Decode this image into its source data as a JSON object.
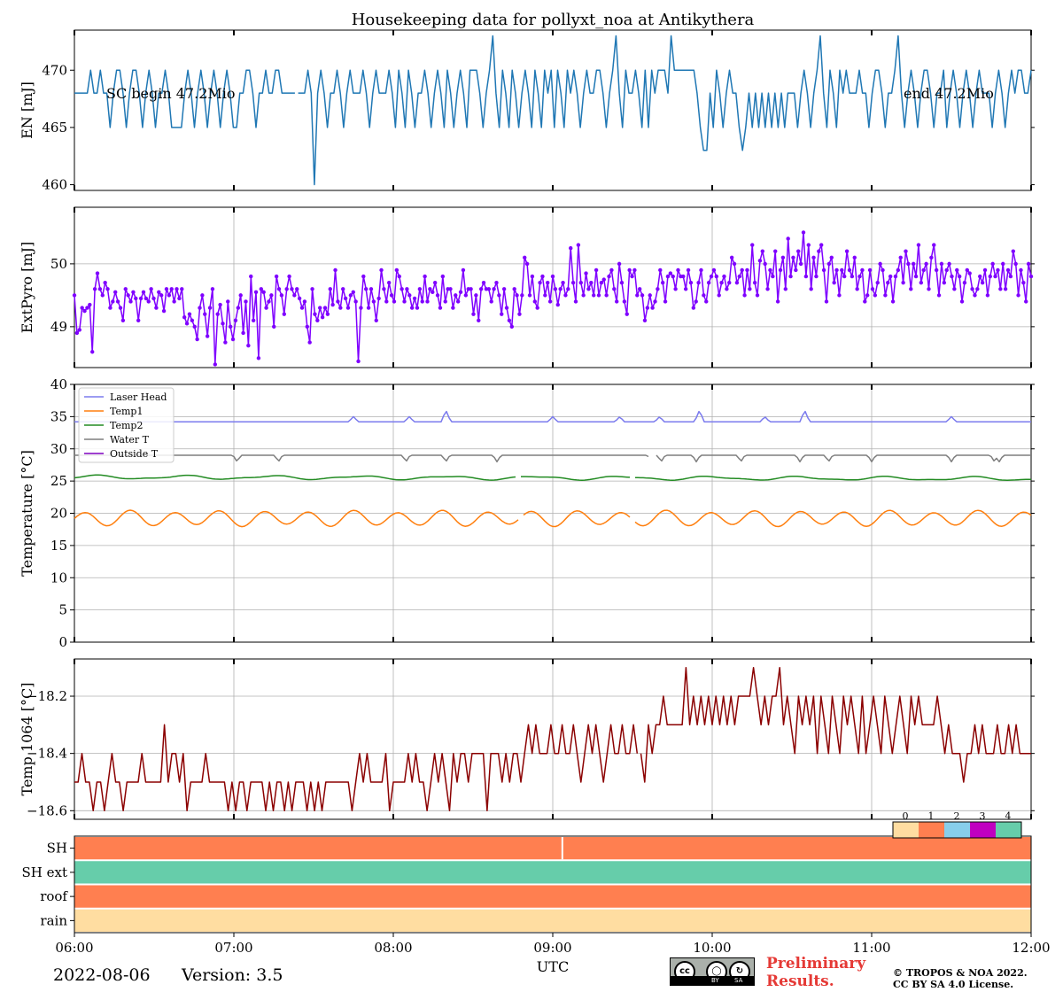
{
  "title": "Housekeeping data for pollyxt_noa at Antikythera",
  "footer": {
    "date": "2022-08-06",
    "version": "Version: 3.5",
    "cc_label": "cc",
    "cc_by": "BY",
    "cc_sa": "SA",
    "preliminary_line1": "Preliminary",
    "preliminary_line2": "Results.",
    "copyright_line1": "© TROPOS & NOA 2022.",
    "copyright_line2": "CC BY SA 4.0 License."
  },
  "chart_data": [
    {
      "id": "en",
      "type": "line",
      "ylabel": "EN [mJ]",
      "ylim": [
        459.5,
        473.5
      ],
      "yticks": [
        460,
        465,
        470
      ],
      "grid": false,
      "color": "#1f77b4",
      "annotations": [
        {
          "text": "SC begin 47.2Mio",
          "x": 6.2,
          "y": 468
        },
        {
          "text": "end 47.2Mio",
          "x": 11.2,
          "y": 468
        }
      ],
      "x_start": 6.0,
      "x_end": 12.0,
      "gaps": [
        7.4
      ],
      "values": [
        468,
        468,
        468,
        468,
        468,
        470,
        468,
        468,
        470,
        468,
        468,
        465,
        468,
        470,
        470,
        468,
        465,
        468,
        470,
        470,
        468,
        465,
        468,
        470,
        468,
        465,
        468,
        468,
        470,
        468,
        465,
        465,
        465,
        465,
        468,
        470,
        468,
        465,
        468,
        470,
        468,
        465,
        468,
        470,
        468,
        465,
        468,
        470,
        468,
        465,
        465,
        468,
        468,
        470,
        470,
        468,
        465,
        468,
        468,
        470,
        468,
        468,
        470,
        470,
        468,
        468,
        468,
        468,
        468,
        468,
        468,
        468,
        470,
        468,
        460,
        468,
        470,
        468,
        465,
        468,
        468,
        470,
        468,
        465,
        468,
        470,
        468,
        468,
        468,
        470,
        468,
        465,
        468,
        470,
        468,
        468,
        468,
        470,
        468,
        465,
        470,
        468,
        465,
        470,
        468,
        465,
        468,
        468,
        470,
        468,
        465,
        468,
        470,
        468,
        465,
        470,
        468,
        465,
        468,
        470,
        468,
        465,
        470,
        470,
        470,
        468,
        465,
        468,
        470,
        473,
        468,
        465,
        470,
        468,
        465,
        470,
        468,
        465,
        468,
        470,
        468,
        465,
        470,
        468,
        465,
        470,
        468,
        470,
        465,
        470,
        468,
        465,
        470,
        468,
        470,
        468,
        465,
        468,
        470,
        468,
        468,
        470,
        470,
        468,
        465,
        468,
        470,
        473,
        468,
        465,
        470,
        468,
        468,
        470,
        468,
        465,
        470,
        465,
        470,
        468,
        470,
        470,
        470,
        468,
        473,
        470,
        470,
        470,
        470,
        470,
        470,
        470,
        468,
        465,
        463,
        463,
        468,
        465,
        470,
        468,
        465,
        468,
        470,
        468,
        468,
        465,
        463,
        465,
        468,
        465,
        468,
        465,
        468,
        465,
        468,
        465,
        468,
        465,
        468,
        465,
        468,
        468,
        468,
        465,
        468,
        470,
        468,
        465,
        468,
        470,
        473,
        468,
        465,
        470,
        468,
        465,
        470,
        468,
        470,
        468,
        468,
        468,
        470,
        468,
        468,
        465,
        468,
        470,
        470,
        468,
        465,
        468,
        468,
        470,
        473,
        468,
        465,
        468,
        470,
        468,
        465,
        468,
        470,
        470,
        468,
        465,
        468,
        468,
        470,
        465,
        468,
        470,
        468,
        465,
        468,
        470,
        468,
        465,
        468,
        470,
        468,
        468,
        468,
        465,
        468,
        470,
        468,
        465,
        468,
        470,
        468,
        470,
        470,
        468,
        468,
        470
      ]
    },
    {
      "id": "extpyro",
      "type": "line",
      "ylabel": "ExtPyro [mJ]",
      "ylim": [
        48.35,
        50.9
      ],
      "yticks": [
        49,
        50
      ],
      "grid": true,
      "color": "#7f00ff",
      "markers": true,
      "x_start": 6.0,
      "x_end": 12.0,
      "values": [
        49.5,
        48.9,
        48.95,
        49.3,
        49.25,
        49.3,
        49.35,
        48.6,
        49.6,
        49.85,
        49.6,
        49.5,
        49.7,
        49.6,
        49.3,
        49.4,
        49.55,
        49.4,
        49.3,
        49.1,
        49.6,
        49.5,
        49.4,
        49.55,
        49.45,
        49.1,
        49.45,
        49.55,
        49.45,
        49.4,
        49.6,
        49.45,
        49.3,
        49.55,
        49.5,
        49.25,
        49.6,
        49.5,
        49.6,
        49.4,
        49.6,
        49.45,
        49.6,
        49.15,
        49.05,
        49.2,
        49.1,
        49.0,
        48.8,
        49.3,
        49.5,
        49.2,
        48.85,
        49.3,
        49.6,
        48.4,
        49.2,
        49.35,
        49.05,
        48.75,
        49.4,
        49.0,
        48.8,
        49.1,
        49.3,
        49.5,
        48.9,
        49.4,
        48.7,
        49.8,
        49.1,
        49.55,
        48.5,
        49.6,
        49.55,
        49.3,
        49.4,
        49.5,
        49.0,
        49.8,
        49.6,
        49.5,
        49.2,
        49.6,
        49.8,
        49.6,
        49.5,
        49.6,
        49.45,
        49.3,
        49.4,
        49.0,
        48.75,
        49.6,
        49.2,
        49.1,
        49.3,
        49.15,
        49.3,
        49.2,
        49.6,
        49.35,
        49.9,
        49.4,
        49.3,
        49.6,
        49.45,
        49.3,
        49.5,
        49.55,
        49.4,
        48.45,
        49.3,
        49.8,
        49.6,
        49.3,
        49.6,
        49.4,
        49.1,
        49.45,
        49.9,
        49.6,
        49.4,
        49.7,
        49.5,
        49.4,
        49.9,
        49.8,
        49.6,
        49.4,
        49.6,
        49.5,
        49.3,
        49.45,
        49.3,
        49.6,
        49.4,
        49.8,
        49.4,
        49.6,
        49.55,
        49.7,
        49.5,
        49.3,
        49.8,
        49.4,
        49.6,
        49.6,
        49.3,
        49.5,
        49.4,
        49.55,
        49.9,
        49.5,
        49.6,
        49.6,
        49.2,
        49.5,
        49.1,
        49.6,
        49.7,
        49.6,
        49.6,
        49.4,
        49.6,
        49.7,
        49.5,
        49.2,
        49.6,
        49.3,
        49.1,
        49.0,
        49.6,
        49.5,
        49.2,
        49.5,
        50.1,
        50.0,
        49.5,
        49.8,
        49.4,
        49.3,
        49.7,
        49.8,
        49.5,
        49.7,
        49.4,
        49.8,
        49.6,
        49.35,
        49.6,
        49.7,
        49.5,
        49.6,
        50.25,
        49.7,
        49.4,
        50.3,
        49.7,
        49.5,
        49.85,
        49.6,
        49.7,
        49.5,
        49.9,
        49.5,
        49.7,
        49.75,
        49.5,
        49.8,
        49.9,
        49.6,
        49.4,
        50.0,
        49.7,
        49.4,
        49.2,
        49.9,
        49.8,
        49.9,
        49.5,
        49.6,
        49.5,
        49.1,
        49.3,
        49.5,
        49.3,
        49.4,
        49.6,
        49.9,
        49.7,
        49.4,
        49.8,
        49.85,
        49.8,
        49.6,
        49.9,
        49.8,
        49.8,
        49.6,
        49.9,
        49.7,
        49.3,
        49.4,
        49.7,
        49.9,
        49.5,
        49.4,
        49.7,
        49.8,
        49.9,
        49.8,
        49.5,
        49.7,
        49.8,
        49.6,
        49.7,
        50.1,
        50.0,
        49.7,
        49.8,
        49.9,
        49.5,
        49.9,
        49.6,
        50.3,
        49.7,
        49.5,
        50.05,
        50.2,
        50.0,
        49.6,
        49.9,
        49.8,
        50.2,
        49.4,
        49.9,
        50.1,
        49.6,
        50.4,
        49.8,
        50.1,
        49.9,
        50.2,
        50.0,
        50.5,
        49.8,
        50.3,
        49.6,
        50.1,
        49.8,
        50.2,
        50.3,
        49.9,
        49.4,
        50.0,
        50.1,
        49.7,
        49.9,
        49.5,
        49.9,
        49.8,
        50.2,
        49.9,
        49.8,
        50.1,
        49.6,
        49.8,
        49.9,
        49.4,
        49.5,
        49.9,
        49.6,
        49.5,
        49.7,
        50.0,
        49.9,
        49.5,
        49.7,
        49.8,
        49.4,
        49.8,
        49.9,
        50.1,
        49.7,
        50.2,
        50.0,
        49.6,
        50.0,
        49.8,
        50.3,
        49.7,
        49.9,
        50.0,
        49.6,
        50.1,
        50.3,
        49.9,
        49.5,
        50.0,
        49.7,
        49.9,
        50.0,
        49.8,
        49.6,
        49.9,
        49.8,
        49.4,
        49.7,
        49.9,
        49.85,
        49.6,
        49.5,
        49.6,
        49.8,
        49.7,
        49.9,
        49.5,
        49.8,
        50.0,
        49.8,
        49.9,
        49.6,
        50.0,
        49.6,
        49.9,
        49.8,
        50.2,
        50.0,
        49.5,
        49.9,
        49.7,
        49.4,
        50.0,
        49.8
      ]
    },
    {
      "id": "temperature",
      "type": "line",
      "ylabel": "Temperature [$^\\circ C$]",
      "ylim": [
        0,
        40
      ],
      "yticks": [
        0,
        5,
        10,
        15,
        20,
        25,
        30,
        35,
        40
      ],
      "grid": true,
      "legend_position": "top-left",
      "x_start": 6.0,
      "x_end": 12.0,
      "series": [
        {
          "name": "Laser Head",
          "color": "#7b7bee",
          "base": 34.2,
          "spikes": [
            [
              7.75,
              35
            ],
            [
              8.1,
              35
            ],
            [
              8.33,
              36
            ],
            [
              9.0,
              35
            ],
            [
              9.42,
              35
            ],
            [
              9.67,
              35
            ],
            [
              9.92,
              36
            ],
            [
              10.33,
              35
            ],
            [
              10.58,
              36
            ],
            [
              11.5,
              35
            ]
          ]
        },
        {
          "name": "Temp1",
          "color": "#ff7f0e",
          "mean": 19.2,
          "amp": 1.2,
          "period_h": 0.28,
          "gaps": [
            8.8,
            9.5
          ]
        },
        {
          "name": "Temp2",
          "color": "#228b22",
          "mean": 25.8,
          "amp": 0.25,
          "period_h": 0.55,
          "gaps": [
            8.78,
            9.5
          ]
        },
        {
          "name": "Water T",
          "color": "#7f7f7f",
          "base": 29,
          "dips": [
            7.02,
            7.28,
            8.08,
            8.33,
            8.65,
            9.62,
            9.68,
            9.9,
            10.18,
            10.55,
            10.73,
            11.0,
            11.5,
            11.77,
            11.8
          ],
          "gap": [
            9.6,
            9.64
          ]
        },
        {
          "name": "Outside T",
          "color": "#7f00bf",
          "values": []
        }
      ]
    },
    {
      "id": "temp1064",
      "type": "line",
      "ylabel": "Temp 1064 [$^\\circ C$]",
      "ylim": [
        -18.63,
        -18.07
      ],
      "yticks": [
        -18.6,
        -18.4,
        -18.2
      ],
      "ytick_labels": [
        "−18.6",
        "−18.4",
        "−18.2"
      ],
      "grid": true,
      "color": "#8b0000",
      "x_start": 6.0,
      "x_end": 12.0,
      "gaps": [
        9.53
      ],
      "values": [
        -18.5,
        -18.5,
        -18.4,
        -18.5,
        -18.5,
        -18.6,
        -18.5,
        -18.5,
        -18.6,
        -18.5,
        -18.4,
        -18.5,
        -18.5,
        -18.6,
        -18.5,
        -18.5,
        -18.5,
        -18.5,
        -18.4,
        -18.5,
        -18.5,
        -18.5,
        -18.5,
        -18.5,
        -18.3,
        -18.5,
        -18.4,
        -18.4,
        -18.5,
        -18.4,
        -18.6,
        -18.5,
        -18.5,
        -18.5,
        -18.5,
        -18.4,
        -18.5,
        -18.5,
        -18.5,
        -18.5,
        -18.5,
        -18.6,
        -18.5,
        -18.6,
        -18.5,
        -18.5,
        -18.6,
        -18.5,
        -18.5,
        -18.5,
        -18.5,
        -18.6,
        -18.5,
        -18.6,
        -18.5,
        -18.5,
        -18.6,
        -18.5,
        -18.6,
        -18.5,
        -18.5,
        -18.5,
        -18.6,
        -18.5,
        -18.6,
        -18.5,
        -18.6,
        -18.5,
        -18.5,
        -18.5,
        -18.5,
        -18.5,
        -18.5,
        -18.5,
        -18.6,
        -18.5,
        -18.4,
        -18.5,
        -18.4,
        -18.5,
        -18.5,
        -18.5,
        -18.5,
        -18.4,
        -18.6,
        -18.5,
        -18.5,
        -18.5,
        -18.5,
        -18.4,
        -18.5,
        -18.4,
        -18.5,
        -18.5,
        -18.6,
        -18.5,
        -18.4,
        -18.5,
        -18.4,
        -18.5,
        -18.6,
        -18.4,
        -18.5,
        -18.4,
        -18.4,
        -18.5,
        -18.4,
        -18.4,
        -18.4,
        -18.4,
        -18.6,
        -18.4,
        -18.4,
        -18.4,
        -18.5,
        -18.4,
        -18.5,
        -18.4,
        -18.4,
        -18.5,
        -18.4,
        -18.3,
        -18.4,
        -18.3,
        -18.4,
        -18.4,
        -18.4,
        -18.3,
        -18.4,
        -18.4,
        -18.3,
        -18.4,
        -18.4,
        -18.3,
        -18.4,
        -18.5,
        -18.4,
        -18.3,
        -18.4,
        -18.3,
        -18.4,
        -18.5,
        -18.4,
        -18.3,
        -18.4,
        -18.4,
        -18.3,
        -18.4,
        -18.4,
        -18.3,
        -18.4,
        -18.4,
        -18.5,
        -18.3,
        -18.4,
        -18.3,
        -18.3,
        -18.2,
        -18.3,
        -18.3,
        -18.3,
        -18.3,
        -18.3,
        -18.1,
        -18.3,
        -18.2,
        -18.3,
        -18.2,
        -18.3,
        -18.2,
        -18.3,
        -18.2,
        -18.3,
        -18.2,
        -18.3,
        -18.2,
        -18.3,
        -18.2,
        -18.2,
        -18.2,
        -18.2,
        -18.1,
        -18.2,
        -18.3,
        -18.2,
        -18.3,
        -18.2,
        -18.2,
        -18.1,
        -18.3,
        -18.2,
        -18.3,
        -18.4,
        -18.2,
        -18.3,
        -18.2,
        -18.3,
        -18.2,
        -18.4,
        -18.2,
        -18.3,
        -18.4,
        -18.2,
        -18.3,
        -18.4,
        -18.2,
        -18.3,
        -18.2,
        -18.3,
        -18.4,
        -18.2,
        -18.4,
        -18.3,
        -18.2,
        -18.3,
        -18.4,
        -18.2,
        -18.3,
        -18.4,
        -18.3,
        -18.2,
        -18.3,
        -18.4,
        -18.2,
        -18.3,
        -18.2,
        -18.3,
        -18.3,
        -18.3,
        -18.3,
        -18.2,
        -18.3,
        -18.4,
        -18.3,
        -18.4,
        -18.4,
        -18.4,
        -18.5,
        -18.4,
        -18.4,
        -18.3,
        -18.4,
        -18.3,
        -18.4,
        -18.4,
        -18.4,
        -18.3,
        -18.4,
        -18.4,
        -18.3,
        -18.4,
        -18.3,
        -18.4,
        -18.4,
        -18.4,
        -18.4
      ]
    },
    {
      "id": "status",
      "type": "heatmap",
      "rows": [
        "SH",
        "SH ext",
        "roof",
        "rain"
      ],
      "row_status": [
        1,
        4,
        1,
        0
      ],
      "breaks": [
        {
          "row": "SH",
          "x": 9.06
        }
      ],
      "colorbar": {
        "ticks": [
          "0",
          "1",
          "2",
          "3",
          "4"
        ],
        "colors": [
          "#ffdda1",
          "#ff7f50",
          "#87ceeb",
          "#c000c0",
          "#66cdaa"
        ]
      },
      "xlabel": "UTC",
      "xticks": [
        "06:00",
        "07:00",
        "08:00",
        "09:00",
        "10:00",
        "11:00",
        "12:00"
      ],
      "xlim": [
        6,
        12
      ]
    }
  ]
}
